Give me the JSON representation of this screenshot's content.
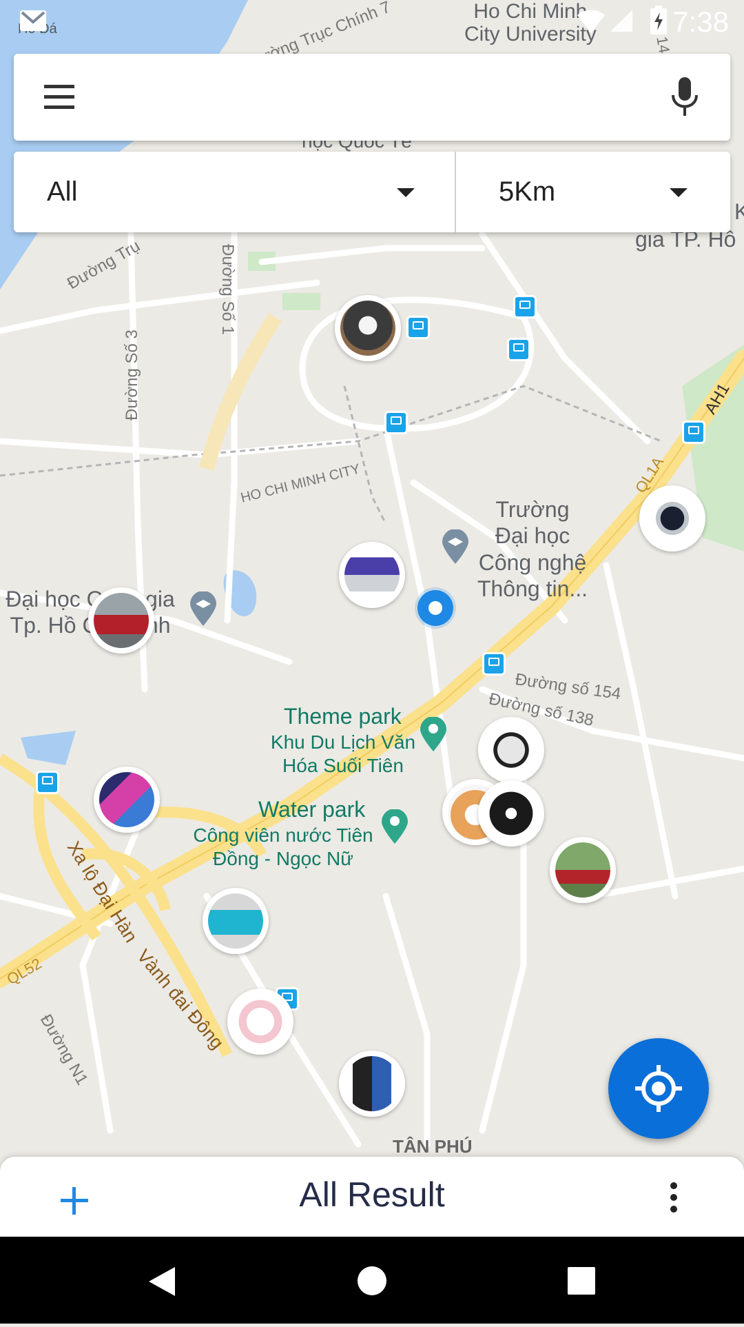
{
  "status_bar": {
    "time": "7:38",
    "icons": [
      "gmail-icon",
      "wifi-icon",
      "cell-signal-icon",
      "battery-charging-icon"
    ]
  },
  "search": {
    "menu_icon": "menu-icon",
    "mic_icon": "mic-icon",
    "placeholder": ""
  },
  "filters": {
    "category": {
      "selected": "All"
    },
    "distance": {
      "selected": "5Km"
    }
  },
  "map": {
    "labels": {
      "hcm_uni": "Ho Chi Minh\nCity University",
      "gia_tp_ho": "gia TP. Hồ",
      "truong": "Trường\nĐại học\nCông nghệ\nThông tin...",
      "dai_hoc_qg": "Đại học Quốc gia\nTp. Hồ Chí Minh",
      "theme_park": "Theme park",
      "khu_du_lich": "Khu Du Lịch Văn\nHóa Suối Tiên",
      "water_park": "Water park",
      "cong_vien": "Công viên nước Tiên\nĐồng - Ngọc Nữ",
      "tan_phu": "TÂN PHÚ",
      "hoc_quoc_te": "học Quốc Tế",
      "ho_da": "Hồ Đá",
      "truc_chinh": "Đường Trục Chính 7",
      "duong_so_3": "Đường Số 3",
      "duong_so_1": "Đường Số 1",
      "duong_tru": "Đường Trụ",
      "hcm_city": "HO CHI MINH CITY",
      "duong_154": "Đường số 154",
      "duong_138": "Đường số 138",
      "xa_lo": "Xa lộ Đại Hàn",
      "vanh_dai": "Vành đai Đông",
      "duong_n1": "Đường N1",
      "ql52": "QL52",
      "ql1a": "QL1A",
      "ah1": "AH1",
      "n14": "14",
      "k_edge": "K"
    },
    "markers": [
      "husky-dog",
      "wristwatch",
      "laptop",
      "red-car",
      "scooter",
      "shiba-plush",
      "motorbike-tires",
      "smartphone",
      "red-motorbike",
      "blue-basket",
      "hello-kitty-mug",
      "motorbike-battery"
    ]
  },
  "fab": {
    "icon": "my-location-icon"
  },
  "bottom_bar": {
    "add_icon": "plus-icon",
    "title": "All Result",
    "more_icon": "more-vert-icon"
  },
  "nav_bar": {
    "icons": [
      "back-icon",
      "home-icon",
      "recents-icon"
    ]
  },
  "colors": {
    "accent": "#0a6fd8",
    "add_icon": "#1e88e5",
    "title": "#252b48",
    "bus_stop": "#1aa3e8",
    "highway": "#fbe18c"
  }
}
